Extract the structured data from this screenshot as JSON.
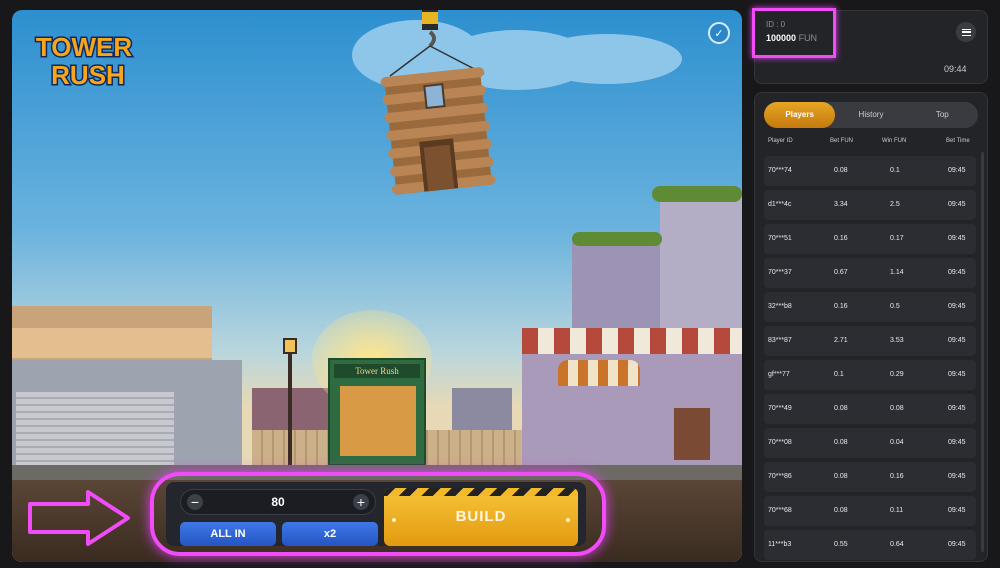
{
  "game": {
    "logo_line1": "TOWER",
    "logo_line2": "RUSH",
    "shop_sign": "Tower Rush"
  },
  "bet": {
    "minus": "−",
    "plus": "+",
    "value": "80",
    "all_in_label": "ALL IN",
    "x2_label": "x2",
    "build_label": "BUILD"
  },
  "user": {
    "id_label": "ID : 0",
    "balance": "100000",
    "currency": "FUN",
    "time": "09:44"
  },
  "tabs": [
    {
      "label": "Players",
      "active": true
    },
    {
      "label": "History",
      "active": false
    },
    {
      "label": "Top",
      "active": false
    }
  ],
  "columns": {
    "player_id": "Player ID",
    "bet": "Bet  FUN",
    "win": "Win  FUN",
    "bet_time": "Bet Time"
  },
  "players": [
    {
      "id": "70***74",
      "bet": "0.08",
      "win": "0.1",
      "time": "09:45"
    },
    {
      "id": "d1***4c",
      "bet": "3.34",
      "win": "2.5",
      "time": "09:45"
    },
    {
      "id": "70***51",
      "bet": "0.16",
      "win": "0.17",
      "time": "09:45"
    },
    {
      "id": "70***37",
      "bet": "0.67",
      "win": "1.14",
      "time": "09:45"
    },
    {
      "id": "32***b8",
      "bet": "0.16",
      "win": "0.5",
      "time": "09:45"
    },
    {
      "id": "83***87",
      "bet": "2.71",
      "win": "3.53",
      "time": "09:45"
    },
    {
      "id": "gf***77",
      "bet": "0.1",
      "win": "0.29",
      "time": "09:45"
    },
    {
      "id": "70***49",
      "bet": "0.08",
      "win": "0.08",
      "time": "09:45"
    },
    {
      "id": "70***08",
      "bet": "0.08",
      "win": "0.04",
      "time": "09:45"
    },
    {
      "id": "70***86",
      "bet": "0.08",
      "win": "0.16",
      "time": "09:45"
    },
    {
      "id": "70***68",
      "bet": "0.08",
      "win": "0.11",
      "time": "09:45"
    },
    {
      "id": "11***b3",
      "bet": "0.55",
      "win": "0.64",
      "time": "09:45"
    }
  ],
  "colors": {
    "highlight": "#f04cf7",
    "build_button": "#f2b52c",
    "action_button": "#3267d8",
    "tab_active": "#e0981d"
  }
}
